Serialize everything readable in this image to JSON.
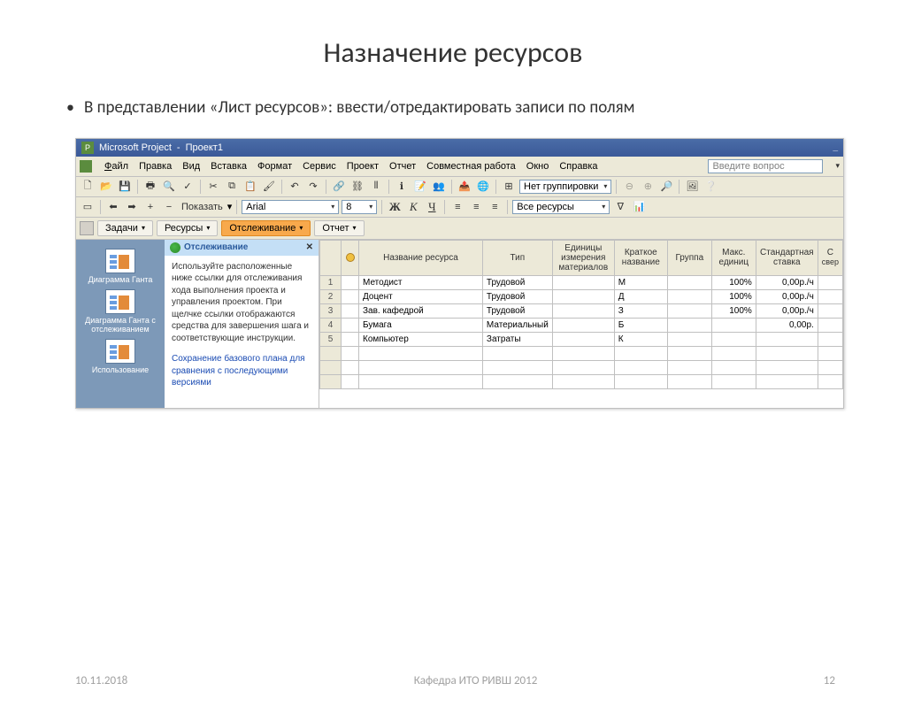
{
  "slide": {
    "title": "Назначение ресурсов",
    "bullet": "В представлении «Лист ресурсов»: ввести/отредактировать записи по полям"
  },
  "titlebar": {
    "app": "Microsoft Project",
    "doc": "Проект1"
  },
  "menu": {
    "file": "Файл",
    "edit": "Правка",
    "view": "Вид",
    "insert": "Вставка",
    "format": "Формат",
    "tools": "Сервис",
    "project": "Проект",
    "report": "Отчет",
    "collab": "Совместная работа",
    "window": "Окно",
    "help": "Справка",
    "help_placeholder": "Введите вопрос"
  },
  "toolbar": {
    "show": "Показать",
    "font": "Arial",
    "size": "8",
    "grouping": "Нет группировки",
    "filter": "Все ресурсы"
  },
  "nav": {
    "tasks": "Задачи",
    "resources": "Ресурсы",
    "tracking": "Отслеживание",
    "report": "Отчет"
  },
  "sidebar": {
    "items": [
      {
        "label": "Диаграмма Ганта"
      },
      {
        "label": "Диаграмма Ганта с отслеживанием"
      },
      {
        "label": "Использование"
      }
    ]
  },
  "guidance": {
    "title": "Отслеживание",
    "body": "Используйте расположенные ниже ссылки для отслеживания хода выполнения проекта и управления проектом. При щелчке ссылки отображаются средства для завершения шага и соответствующие инструкции.",
    "link": "Сохранение базового плана для сравнения с последующими версиями"
  },
  "table": {
    "cols": {
      "name": "Название ресурса",
      "type": "Тип",
      "unit": "Единицы измерения материалов",
      "short": "Краткое название",
      "group": "Группа",
      "max": "Макс. единиц",
      "rate": "Стандартная ставка",
      "last": "С"
    },
    "sub_last": "свер",
    "rows": [
      {
        "n": "1",
        "name": "Методист",
        "type": "Трудовой",
        "unit": "",
        "short": "М",
        "group": "",
        "max": "100%",
        "rate": "0,00р./ч"
      },
      {
        "n": "2",
        "name": "Доцент",
        "type": "Трудовой",
        "unit": "",
        "short": "Д",
        "group": "",
        "max": "100%",
        "rate": "0,00р./ч"
      },
      {
        "n": "3",
        "name": "Зав. кафедрой",
        "type": "Трудовой",
        "unit": "",
        "short": "З",
        "group": "",
        "max": "100%",
        "rate": "0,00р./ч"
      },
      {
        "n": "4",
        "name": "Бумага",
        "type": "Материальный",
        "unit": "",
        "short": "Б",
        "group": "",
        "max": "",
        "rate": "0,00р."
      },
      {
        "n": "5",
        "name": "Компьютер",
        "type": "Затраты",
        "unit": "",
        "short": "К",
        "group": "",
        "max": "",
        "rate": ""
      }
    ]
  },
  "footer": {
    "date": "10.11.2018",
    "org": "Кафедра ИТО РИВШ 2012",
    "page": "12"
  }
}
